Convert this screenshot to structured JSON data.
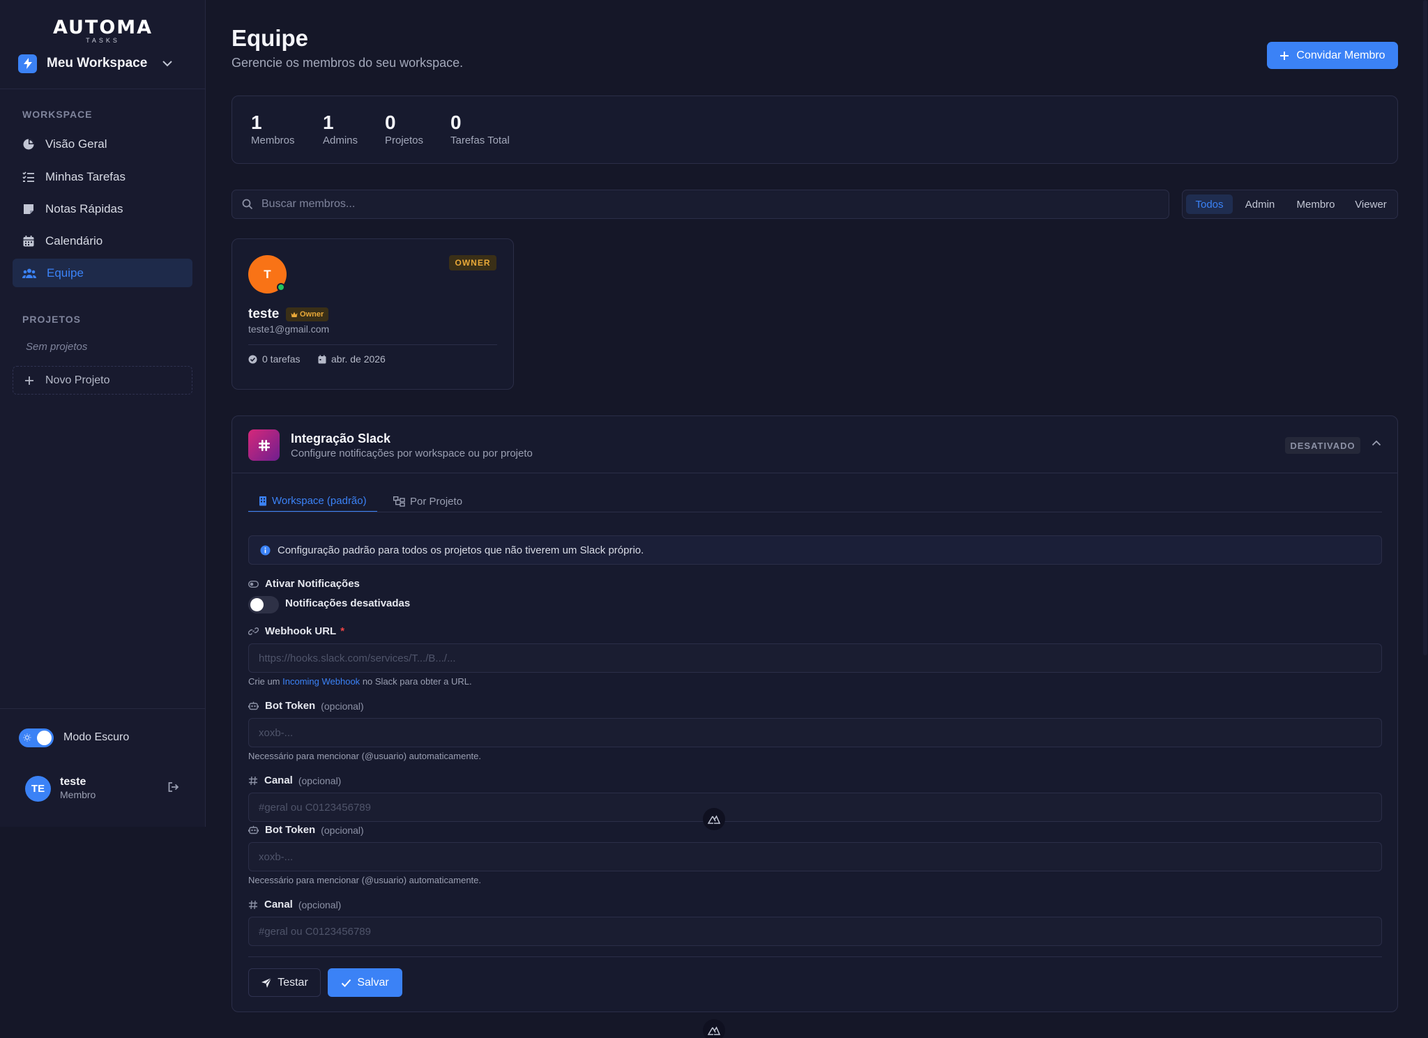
{
  "brand": {
    "logo_main": "AUTOMA",
    "logo_sub": "TASKS"
  },
  "workspace": {
    "name": "Meu Workspace"
  },
  "sidebar": {
    "workspace_heading": "WORKSPACE",
    "items": [
      {
        "label": "Visão Geral",
        "icon": "pie-chart-icon"
      },
      {
        "label": "Minhas Tarefas",
        "icon": "checklist-icon"
      },
      {
        "label": "Notas Rápidas",
        "icon": "sticky-note-icon"
      },
      {
        "label": "Calendário",
        "icon": "calendar-icon"
      },
      {
        "label": "Equipe",
        "icon": "users-icon",
        "active": true
      }
    ],
    "projects_heading": "PROJETOS",
    "no_projects": "Sem projetos",
    "new_project": "Novo Projeto",
    "dark_mode_label": "Modo Escuro",
    "dark_mode_on": true,
    "user": {
      "initials": "TE",
      "name": "teste",
      "role": "Membro"
    }
  },
  "page": {
    "title": "Equipe",
    "subtitle": "Gerencie os membros do seu workspace.",
    "invite_button": "Convidar Membro"
  },
  "stats": [
    {
      "value": "1",
      "label": "Membros"
    },
    {
      "value": "1",
      "label": "Admins"
    },
    {
      "value": "0",
      "label": "Projetos"
    },
    {
      "value": "0",
      "label": "Tarefas Total"
    }
  ],
  "search": {
    "placeholder": "Buscar membros..."
  },
  "filters": [
    {
      "label": "Todos",
      "active": true
    },
    {
      "label": "Admin"
    },
    {
      "label": "Membro"
    },
    {
      "label": "Viewer"
    }
  ],
  "member": {
    "initial": "T",
    "badge": "OWNER",
    "name": "teste",
    "tag": "Owner",
    "email": "teste1@gmail.com",
    "tasks": "0 tarefas",
    "joined": "abr. de 2026"
  },
  "slack": {
    "title": "Integração Slack",
    "subtitle": "Configure notificações por workspace ou por projeto",
    "status": "DESATIVADO",
    "tabs": [
      {
        "label": "Workspace (padrão)",
        "active": true
      },
      {
        "label": "Por Projeto"
      }
    ],
    "info": "Configuração padrão para todos os projetos que não tiverem um Slack próprio.",
    "notifications_label": "Ativar Notificações",
    "notifications_state": "Notificações desativadas",
    "notifications_on": false,
    "webhook_label": "Webhook URL",
    "webhook_required": "*",
    "webhook_placeholder": "https://hooks.slack.com/services/T.../B.../...",
    "webhook_help_prefix": "Crie um",
    "webhook_help_link": "Incoming Webhook",
    "webhook_help_suffix": "no Slack para obter a URL.",
    "bot_token_label": "Bot Token",
    "optional": "(opcional)",
    "bot_token_placeholder": "xoxb-...",
    "bot_token_help": "Necessário para mencionar (@usuario) automaticamente.",
    "channel_label": "Canal",
    "channel_placeholder": "#geral ou C0123456789",
    "test_button": "Testar",
    "save_button": "Salvar"
  },
  "colors": {
    "accent": "#3b82f6",
    "owner": "#e8a838",
    "avatar_member": "#f97316",
    "background": "#151728"
  }
}
